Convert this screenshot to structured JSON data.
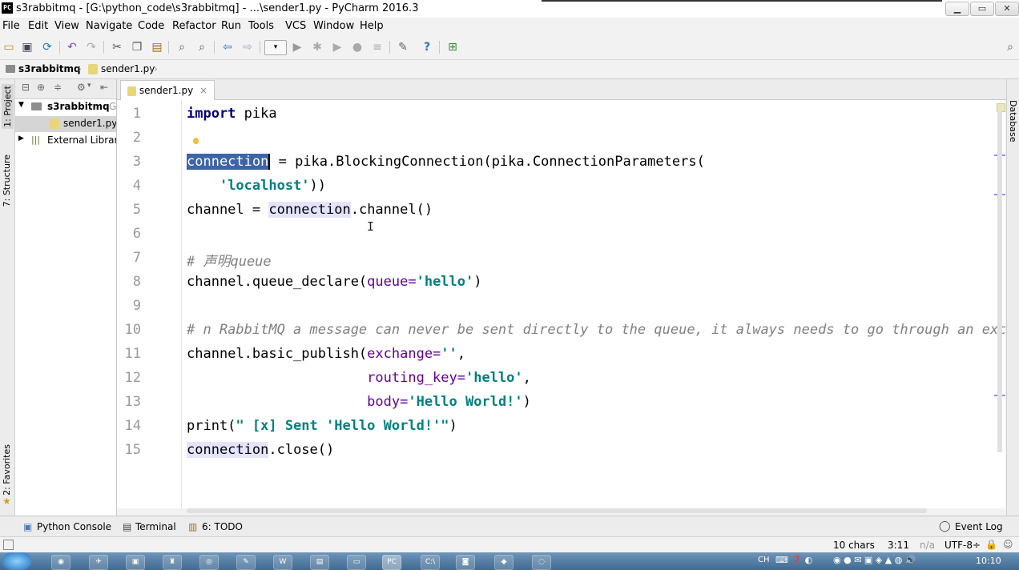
{
  "window": {
    "app_icon": "PC",
    "title": "s3rabbitmq - [G:\\python_code\\s3rabbitmq] - ...\\sender1.py - PyCharm 2016.3",
    "controls": [
      "minimize-icon",
      "maximize-icon",
      "close-icon"
    ]
  },
  "menu": [
    "File",
    "Edit",
    "View",
    "Navigate",
    "Code",
    "Refactor",
    "Run",
    "Tools",
    "VCS",
    "Window",
    "Help"
  ],
  "toolbar_icons": [
    "open-folder-icon",
    "save-icon",
    "sync-icon",
    "undo-icon",
    "redo-icon",
    "cut-icon",
    "copy-icon",
    "paste-icon",
    "find-icon",
    "replace-icon",
    "back-icon",
    "forward-icon",
    "run-config-dropdown",
    "run-icon",
    "debug-icon",
    "coverage-icon",
    "profile-icon",
    "stop-icon",
    "settings-icon",
    "help-icon",
    "vcs-icon",
    "search-everywhere-icon"
  ],
  "breadcrumb": [
    "s3rabbitmq",
    "sender1.py"
  ],
  "left_tool_tabs": {
    "project": "1: Project",
    "structure": "7: Structure",
    "favorites": "2: Favorites"
  },
  "right_tool_tabs": {
    "database": "Database"
  },
  "project_tree": {
    "root": "s3rabbitmq",
    "root_suffix": "G",
    "file": "sender1.py",
    "external": "External Librari"
  },
  "editor": {
    "tab_label": "sender1.py",
    "tab_close": "×",
    "line_numbers": [
      "1",
      "2",
      "3",
      "4",
      "5",
      "6",
      "7",
      "8",
      "9",
      "10",
      "11",
      "12",
      "13",
      "14",
      "15"
    ],
    "tokens": {
      "l1_kw": "import",
      "l1_rest": " pika",
      "l3_sel": "connection",
      "l3_rest": " = pika.BlockingConnection(pika.ConnectionParameters(",
      "l4_pre": "    ",
      "l4_str": "'localhost'",
      "l4_rest": "))",
      "l5_a": "channel = ",
      "l5_use": "connection",
      "l5_b": ".channel()",
      "l7_cmt": "# 声明queue",
      "l8_a": "channel.queue_declare(",
      "l8_param": "queue=",
      "l8_str": "'hello'",
      "l8_b": ")",
      "l10_cmt": "# n RabbitMQ a message can never be sent directly to the queue, it always needs to go through an excha",
      "l11_a": "channel.basic_publish(",
      "l11_param": "exchange=",
      "l11_str": "''",
      "l11_b": ",",
      "l12_pre": "                      ",
      "l12_param": "routing_key=",
      "l12_str": "'hello'",
      "l12_b": ",",
      "l13_pre": "                      ",
      "l13_param": "body=",
      "l13_str": "'Hello World!'",
      "l13_b": ")",
      "l14_a": "print(",
      "l14_str": "\" [x] Sent 'Hello World!'\"",
      "l14_b": ")",
      "l15_use": "connection",
      "l15_b": ".close()"
    }
  },
  "tool_windows": [
    "Python Console",
    "Terminal",
    "6: TODO"
  ],
  "event_log": "Event Log",
  "status": {
    "chars": "10 chars",
    "position": "3:11",
    "na": "n/a",
    "encoding": "UTF-8÷"
  },
  "taskbar": {
    "ime": "CH",
    "clock": "10:10"
  }
}
